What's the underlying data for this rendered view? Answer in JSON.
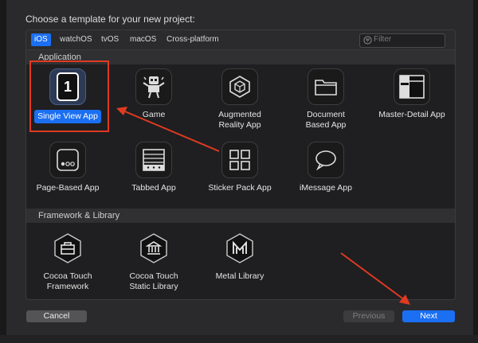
{
  "dialog": {
    "heading": "Choose a template for your new project:"
  },
  "platforms": [
    "iOS",
    "watchOS",
    "tvOS",
    "macOS",
    "Cross-platform"
  ],
  "filter": {
    "placeholder": "Filter"
  },
  "sections": {
    "application": {
      "title": "Application",
      "templates": [
        "Single View App",
        "Game",
        "Augmented Reality App",
        "Document Based App",
        "Master-Detail App",
        "Page-Based App",
        "Tabbed App",
        "Sticker Pack App",
        "iMessage App"
      ]
    },
    "framework": {
      "title": "Framework & Library",
      "templates": [
        "Cocoa Touch Framework",
        "Cocoa Touch Static Library",
        "Metal Library"
      ]
    }
  },
  "icon_labels": {
    "single_view": "1"
  },
  "buttons": {
    "cancel": "Cancel",
    "previous": "Previous",
    "next": "Next"
  },
  "colors": {
    "accent": "#1b6ff2",
    "annotation": "#e03a21"
  },
  "selected_template": "Single View App"
}
